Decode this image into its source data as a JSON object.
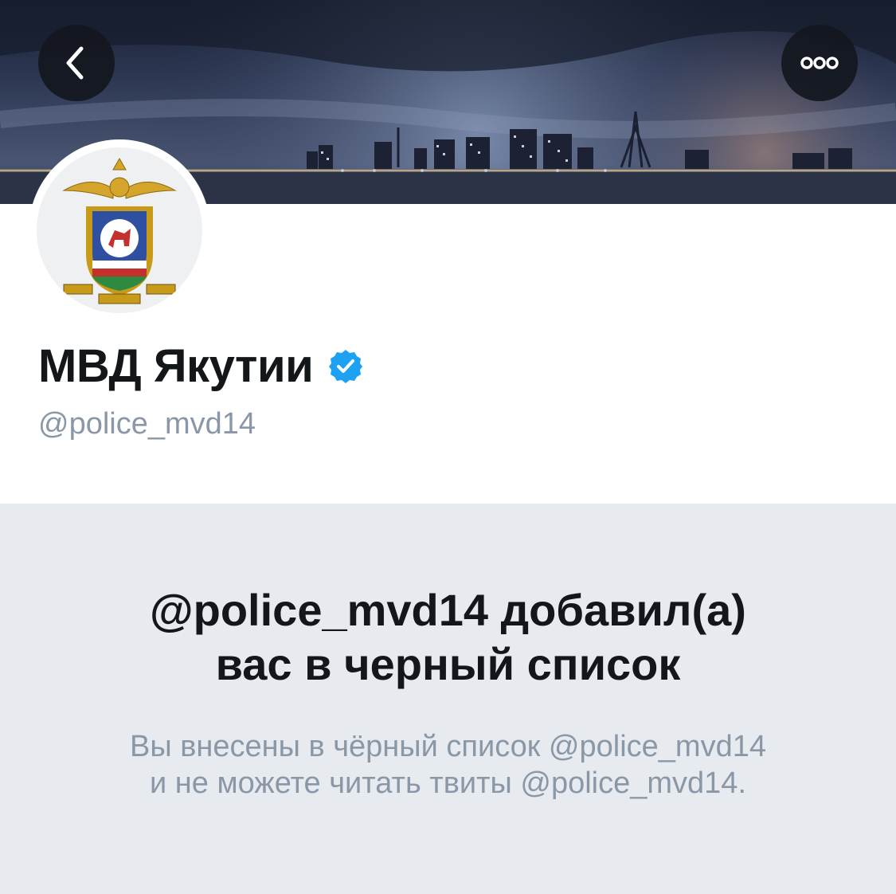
{
  "header": {
    "back_icon": "chevron-left-icon",
    "more_icon": "ellipsis-icon",
    "banner_image": "night-city-skyline"
  },
  "profile": {
    "name": "МВД Якутии",
    "handle": "@police_mvd14",
    "verified": true,
    "verified_color": "#1da1f2",
    "avatar_image": "mvd-yakutia-emblem"
  },
  "blocked": {
    "title_line1": "@police_mvd14 добавил(а)",
    "title_line2": "вас в черный список",
    "desc_line1": "Вы внесены в чёрный список @police_mvd14",
    "desc_line2": "и не можете читать твиты @police_mvd14."
  }
}
